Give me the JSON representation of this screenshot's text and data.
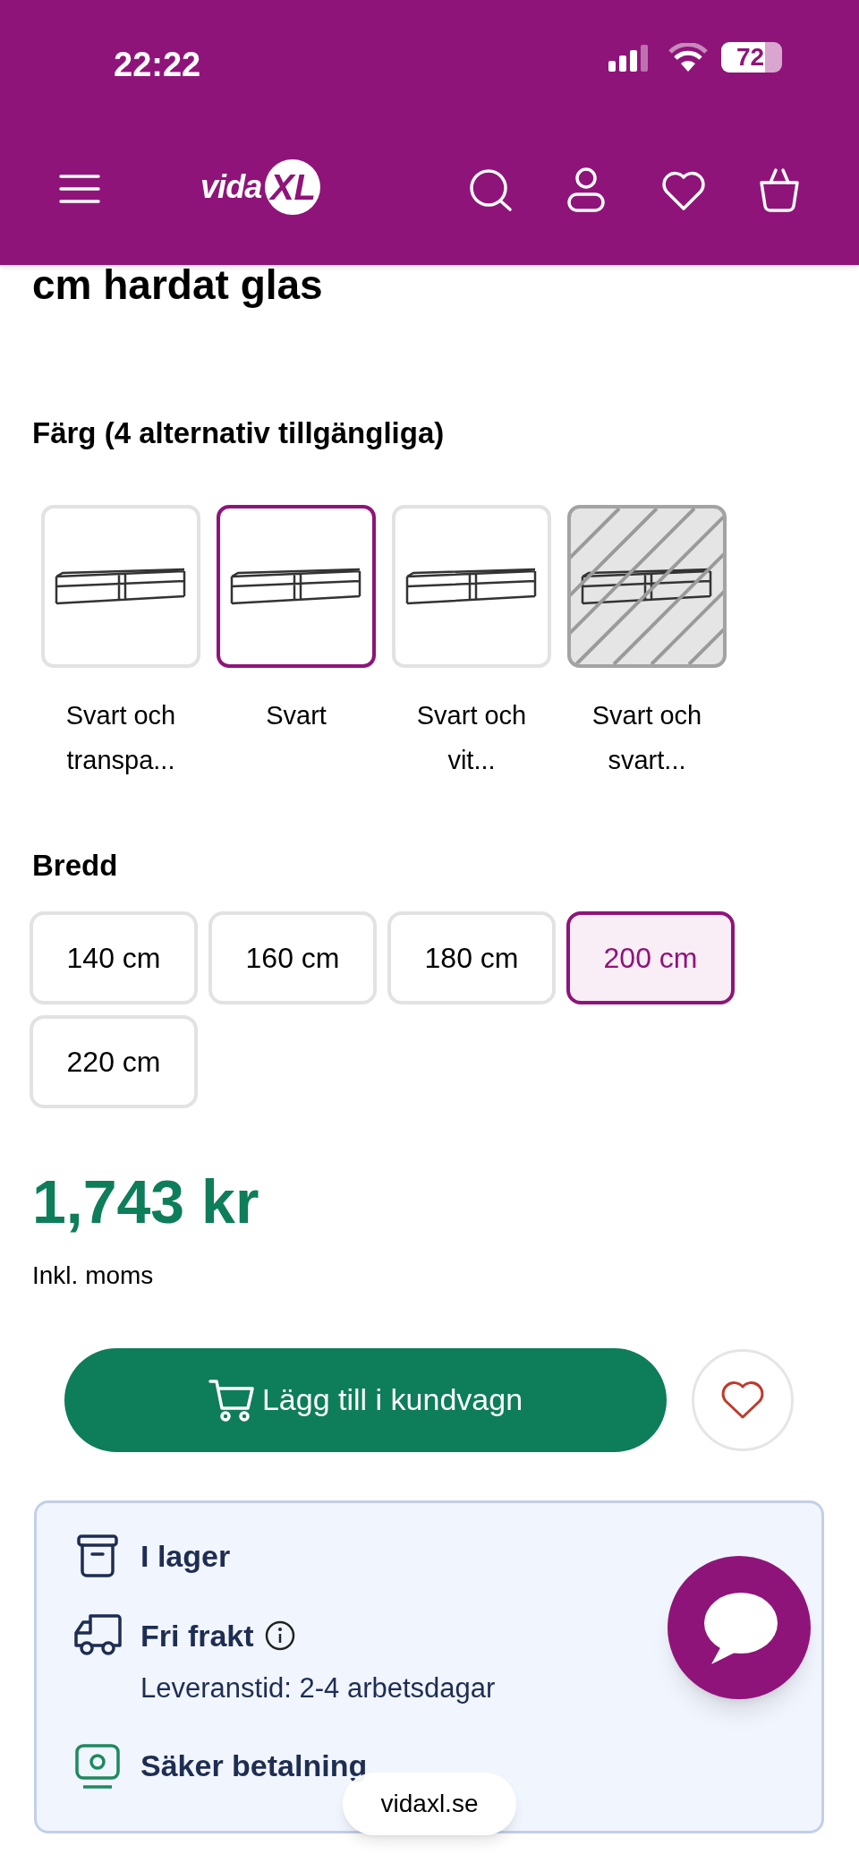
{
  "status_bar": {
    "time": "22:22",
    "battery": "72"
  },
  "header": {
    "logo": "vidaXL"
  },
  "product": {
    "title": "cm hardat glas"
  },
  "color_picker": {
    "heading": "Färg (4 alternativ tillgängliga)",
    "options": [
      {
        "label": "Svart och transpa...",
        "selected": false,
        "disabled": false
      },
      {
        "label": "Svart",
        "selected": true,
        "disabled": false
      },
      {
        "label": "Svart och vit...",
        "selected": false,
        "disabled": false
      },
      {
        "label": "Svart och svart...",
        "selected": false,
        "disabled": true
      }
    ]
  },
  "width_picker": {
    "heading": "Bredd",
    "options": [
      {
        "label": "140 cm",
        "selected": false
      },
      {
        "label": "160 cm",
        "selected": false
      },
      {
        "label": "180 cm",
        "selected": false
      },
      {
        "label": "200 cm",
        "selected": true
      },
      {
        "label": "220 cm",
        "selected": false
      }
    ]
  },
  "price": {
    "amount": "1,743 kr",
    "note": "Inkl. moms"
  },
  "add_to_cart": {
    "label": "Lägg till i kundvagn"
  },
  "info": {
    "items": [
      {
        "kind": "stock",
        "title": "I lager"
      },
      {
        "kind": "shipping",
        "title": "Fri frakt",
        "detail": "Leveranstid: 2-4 arbetsdagar"
      },
      {
        "kind": "payment",
        "title": "Säker betalning"
      }
    ]
  },
  "browser_pill": {
    "url": "vidaxl.se"
  }
}
